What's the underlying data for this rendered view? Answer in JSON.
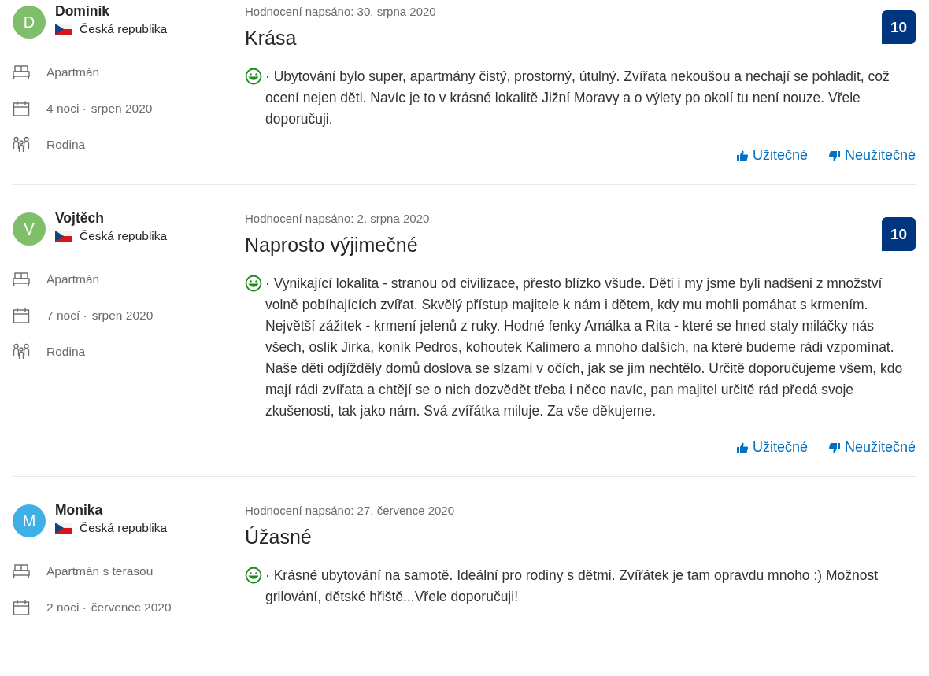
{
  "reviews": [
    {
      "initial": "D",
      "color": "#7fbf6a",
      "name": "Dominik",
      "country": "Česká republika",
      "room": "Apartmán",
      "nights": "4 noci ·",
      "month": "srpen 2020",
      "group": "Rodina",
      "date": "Hodnocení napsáno: 30. srpna 2020",
      "title": "Krása",
      "text": "· Ubytování bylo super, apartmány čistý, prostorný, útulný. Zvířata nekoušou a nechají se pohladit, což ocení nejen děti. Navíc je to v krásné lokalitě Jižní Moravy a o výlety po okolí tu není nouze. Vřele doporučuji.",
      "score": "10",
      "helpful": "Užitečné",
      "unhelpful": "Neužitečné"
    },
    {
      "initial": "V",
      "color": "#7fbf6a",
      "name": "Vojtěch",
      "country": "Česká republika",
      "room": "Apartmán",
      "nights": "7 nocí ·",
      "month": "srpen 2020",
      "group": "Rodina",
      "date": "Hodnocení napsáno: 2. srpna 2020",
      "title": "Naprosto výjimečné",
      "text": "· Vynikající lokalita - stranou od civilizace, přesto blízko všude. Děti i my jsme byli nadšeni z množství volně pobíhajících zvířat. Skvělý přístup majitele k nám i dětem, kdy mu mohli pomáhat s krmením. Největší zážitek - krmení jelenů z ruky. Hodné fenky Amálka a Rita - které se hned staly miláčky nás všech, oslík Jirka, koník Pedros, kohoutek Kalimero a mnoho dalších, na které budeme rádi vzpomínat. Naše děti odjížděly domů doslova se slzami v očích, jak se jim nechtělo. Určitě doporučujeme všem, kdo mají rádi zvířata a chtějí se o nich dozvědět třeba i něco navíc, pan majitel určitě rád předá svoje zkušenosti, tak jako nám. Svá zvířátka miluje. Za vše děkujeme.",
      "score": "10",
      "helpful": "Užitečné",
      "unhelpful": "Neužitečné"
    },
    {
      "initial": "M",
      "color": "#3fb0e6",
      "name": "Monika",
      "country": "Česká republika",
      "room": "Apartmán s terasou",
      "nights": "2 noci ·",
      "month": "červenec 2020",
      "date": "Hodnocení napsáno: 27. července 2020",
      "title": "Úžasné",
      "text": "· Krásné ubytování na samotě. Ideální pro rodiny s dětmi. Zvířátek je tam opravdu mnoho :) Možnost grilování, dětské hřiště...Vřele doporučuji!"
    }
  ]
}
